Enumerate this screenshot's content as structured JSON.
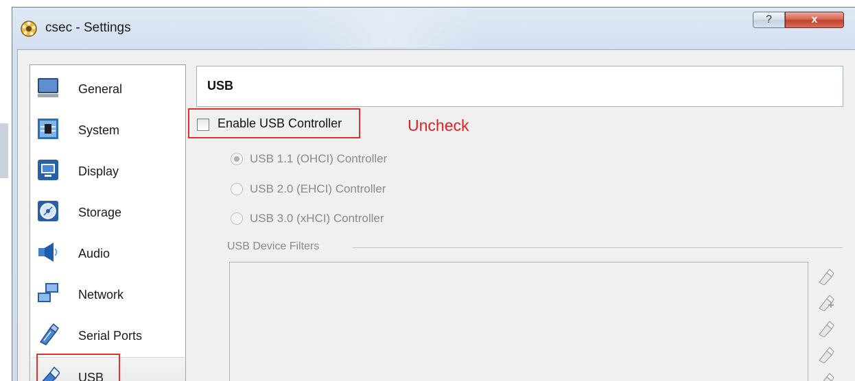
{
  "window": {
    "title": "csec - Settings",
    "help_label": "?",
    "close_label": "x"
  },
  "sidebar": {
    "items": [
      {
        "label": "General",
        "icon": "monitor-icon"
      },
      {
        "label": "System",
        "icon": "chip-icon"
      },
      {
        "label": "Display",
        "icon": "display-icon"
      },
      {
        "label": "Storage",
        "icon": "disk-icon"
      },
      {
        "label": "Audio",
        "icon": "speaker-icon"
      },
      {
        "label": "Network",
        "icon": "network-icon"
      },
      {
        "label": "Serial Ports",
        "icon": "serial-plug-icon"
      },
      {
        "label": "USB",
        "icon": "usb-stick-icon",
        "selected": true
      }
    ]
  },
  "page": {
    "header": "USB",
    "enable_usb_label": "Enable USB Controller",
    "enable_usb_checked": false,
    "annotation": "Uncheck",
    "controllers": [
      {
        "label": "USB 1.1 (OHCI) Controller",
        "selected": true
      },
      {
        "label": "USB 2.0 (EHCI) Controller",
        "selected": false
      },
      {
        "label": "USB 3.0 (xHCI) Controller",
        "selected": false
      }
    ],
    "filters_label": "USB Device Filters",
    "filter_tools": [
      "add-empty-filter-icon",
      "add-device-filter-icon",
      "edit-filter-icon",
      "remove-filter-icon",
      "move-filter-icon"
    ]
  },
  "colors": {
    "highlight": "#e03030",
    "annotation": "#e02020",
    "disabled_text": "#8a8a8a"
  }
}
